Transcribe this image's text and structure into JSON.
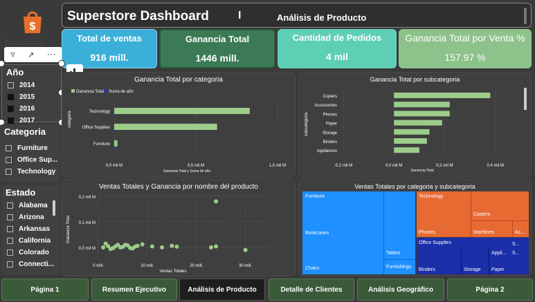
{
  "header": {
    "title": "Superstore Dashboard",
    "separator": "I",
    "subtitle": "Análisis de Producto",
    "logo_text": "Superstore"
  },
  "kpis": [
    {
      "label": "Total de ventas",
      "value": "916 mill.",
      "color": "#3ab0d8"
    },
    {
      "label": "Ganancia Total",
      "value": "1446 mill.",
      "color": "#3b7a55"
    },
    {
      "label": "Cantidad de Pedidos",
      "value": "4 mil",
      "color": "#5ecfb5"
    },
    {
      "label": "Ganancia Total por Venta %",
      "value": "157.97 %",
      "color": "#8dc28a"
    }
  ],
  "slicers": {
    "year": {
      "title": "Año",
      "options": [
        "2014",
        "2015",
        "2016",
        "2017"
      ]
    },
    "category": {
      "title": "Categoria",
      "options": [
        "Furniture",
        "Office Sup...",
        "Technology"
      ]
    },
    "state": {
      "title": "Estado",
      "options": [
        "Alabama",
        "Arizona",
        "Arkansas",
        "California",
        "Colorado",
        "Connecti..."
      ]
    }
  },
  "charts": {
    "by_category": {
      "title": "Ganancia Total por categoria",
      "legend": [
        "Ganancia Total",
        "Suma de año"
      ],
      "ylabel": "categoria",
      "xlabel": "Ganancia Total y Suma de año",
      "ticks": [
        "0,0 mil M",
        "0,5 mil M",
        "1,0 mil M"
      ]
    },
    "by_subcategory": {
      "title": "Ganancia Total por subcategoria",
      "ylabel": "subcategoria",
      "xlabel": "Ganancia Total",
      "ticks": [
        "-0,2 mil M",
        "0,0 mil M",
        "0,2 mil M",
        "0,4 mil M"
      ]
    },
    "scatter": {
      "title": "Ventas Totales y Ganancia por nombre del producto",
      "ylabel": "Ganancia Total",
      "xlabel": "Ventas Totales",
      "yticks": [
        "0,2 mil M",
        "0,1 mil M",
        "0,0 mil M"
      ],
      "xticks": [
        "0 mill.",
        "10 mill.",
        "20 mill.",
        "30 mill."
      ]
    },
    "treemap": {
      "title": "Ventas Totales por categoria y subcategoria",
      "labels": {
        "furniture": "Furniture",
        "bookcases": "Bookcases",
        "chairs": "Chairs",
        "tables": "Tables",
        "furnishings": "Furnishings",
        "technology": "Technology",
        "copiers": "Copiers",
        "phones": "Phones",
        "machines": "Machines",
        "ac": "Ac...",
        "office": "Office Supplies",
        "binders": "Binders",
        "storage": "Storage",
        "appliances": "Appli...",
        "paper": "Paper",
        "s": "S...",
        "s2": "S..."
      }
    }
  },
  "chart_data": [
    {
      "type": "bar",
      "title": "Ganancia Total por categoria",
      "categories": [
        "Technology",
        "Office Supplies",
        "Furniture"
      ],
      "series": [
        {
          "name": "Ganancia Total",
          "values": [
            0.83,
            0.63,
            0.02
          ]
        },
        {
          "name": "Suma de año",
          "values": [
            0.002,
            0.003,
            0.001
          ]
        }
      ],
      "xlabel": "Ganancia Total y Suma de año",
      "ylabel": "categoria",
      "xlim": [
        0,
        1.0
      ]
    },
    {
      "type": "bar",
      "title": "Ganancia Total por subcategoria",
      "categories": [
        "Copiers",
        "Accessories",
        "Phones",
        "Paper",
        "Storage",
        "Binders",
        "Appliances"
      ],
      "values": [
        0.38,
        0.22,
        0.22,
        0.19,
        0.14,
        0.13,
        0.1
      ],
      "xlabel": "Ganancia Total",
      "ylabel": "subcategoria",
      "xlim": [
        -0.2,
        0.45
      ]
    },
    {
      "type": "scatter",
      "title": "Ventas Totales y Ganancia por nombre del producto",
      "xlabel": "Ventas Totales",
      "ylabel": "Ganancia Total",
      "points": [
        [
          1,
          0.0
        ],
        [
          2,
          0.005
        ],
        [
          3,
          -0.003
        ],
        [
          4,
          0.01
        ],
        [
          5,
          0.002
        ],
        [
          6,
          0.008
        ],
        [
          7,
          -0.004
        ],
        [
          8,
          0.006
        ],
        [
          9,
          0.012
        ],
        [
          1.5,
          0.015
        ],
        [
          2.5,
          -0.006
        ],
        [
          3.5,
          0.004
        ],
        [
          4.5,
          0.0
        ],
        [
          5.5,
          0.01
        ],
        [
          6.5,
          -0.002
        ],
        [
          7.5,
          0.003
        ],
        [
          11,
          0.004
        ],
        [
          13,
          0.0
        ],
        [
          15,
          0.006
        ],
        [
          16,
          0.003
        ],
        [
          23,
          0.0
        ],
        [
          24,
          0.004
        ],
        [
          30,
          -0.01
        ],
        [
          24,
          0.18
        ]
      ],
      "xlim": [
        0,
        35
      ],
      "ylim": [
        -0.02,
        0.22
      ]
    }
  ],
  "nav": {
    "tabs": [
      "Página 1",
      "Resumen Ejecutivo",
      "Análisis de Producto",
      "Detalle de Clientes",
      "Análisis Geográfico",
      "Página 2"
    ],
    "active": 2
  },
  "colors": {
    "bar": "#9ccc8a",
    "bar_dark": "#2a3aa0",
    "treemap_furniture": "#1e90ff",
    "treemap_technology": "#e86a33",
    "treemap_office": "#1a2fa8"
  }
}
